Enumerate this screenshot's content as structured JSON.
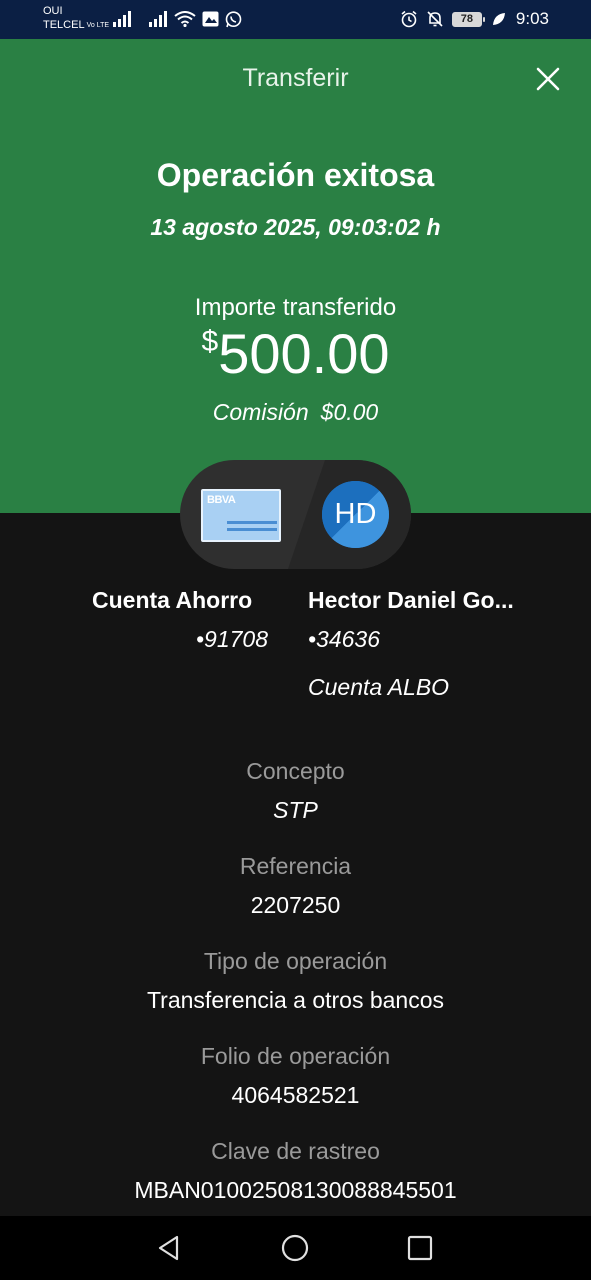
{
  "status_bar": {
    "carrier_top": "OUI",
    "carrier_bottom": "TELCEL",
    "volte": "Vo LTE",
    "battery": "78",
    "time": "9:03"
  },
  "header": {
    "title": "Transferir",
    "close_icon": "close-icon"
  },
  "result": {
    "title": "Operación exitosa",
    "datetime": "13 agosto 2025, 09:03:02 h",
    "amount_label": "Importe transferido",
    "currency_symbol": "$",
    "amount": "500.00",
    "commission_label": "Comisión",
    "commission_value": "$0.00"
  },
  "transfer_visual": {
    "card_brand": "BBVA",
    "avatar_initials": "HD",
    "colors": {
      "pill": "#2f2f2f",
      "avatar": "#1f77c8",
      "card": "#a9d0f3"
    }
  },
  "origin": {
    "name": "Cuenta Ahorro",
    "number": "•91708"
  },
  "destination": {
    "name": "Hector Daniel Go...",
    "number": "•34636",
    "account_type": "Cuenta ALBO"
  },
  "details": [
    {
      "label": "Concepto",
      "value": "STP"
    },
    {
      "label": "Referencia",
      "value": "2207250"
    },
    {
      "label": "Tipo de operación",
      "value": "Transferencia a otros bancos"
    },
    {
      "label": "Folio de operación",
      "value": "4064582521"
    },
    {
      "label": "Clave de rastreo",
      "value": "MBAN01002508130088845501"
    }
  ],
  "colors": {
    "status_bar": "#0b1f44",
    "header": "#2a8044",
    "background": "#141414",
    "detail_label": "#9a9a9a"
  }
}
